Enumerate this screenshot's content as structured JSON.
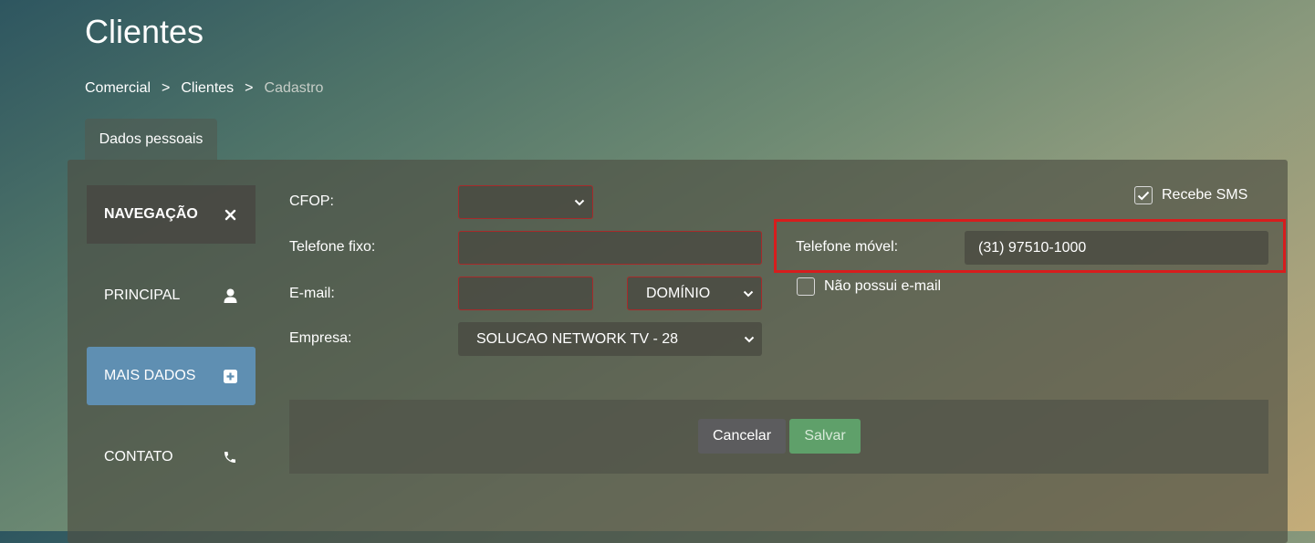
{
  "page": {
    "title": "Clientes"
  },
  "breadcrumb": {
    "items": [
      "Comercial",
      "Clientes",
      "Cadastro"
    ],
    "separator": ">"
  },
  "tabs": [
    {
      "label": "Dados pessoais"
    }
  ],
  "sidebar": {
    "header": {
      "label": "NAVEGAÇÃO",
      "icon": "close-icon"
    },
    "items": [
      {
        "label": "PRINCIPAL",
        "icon": "user-icon",
        "active": false
      },
      {
        "label": "MAIS DADOS",
        "icon": "plus-square-icon",
        "active": true
      },
      {
        "label": "CONTATO",
        "icon": "phone-icon",
        "active": false
      }
    ]
  },
  "form": {
    "cfop": {
      "label": "CFOP:",
      "value": ""
    },
    "telefone_fixo": {
      "label": "Telefone fixo:",
      "value": ""
    },
    "email": {
      "label": "E-mail:",
      "value": "",
      "domain_value": "DOMÍNIO"
    },
    "empresa": {
      "label": "Empresa:",
      "value": "SOLUCAO NETWORK TV - 28"
    },
    "recebe_sms": {
      "label": "Recebe SMS",
      "checked": true
    },
    "telefone_movel": {
      "label": "Telefone móvel:",
      "value": "(31) 97510-1000"
    },
    "nao_possui_email": {
      "label": "Não possui e-mail",
      "checked": false
    }
  },
  "actions": {
    "cancel_label": "Cancelar",
    "save_label": "Salvar"
  },
  "colors": {
    "active_nav": "#5f8fb2",
    "invalid_border": "#a62a2a",
    "highlight": "#d71d1d",
    "save": "#5fa06a",
    "cancel": "#5c5c5e"
  }
}
